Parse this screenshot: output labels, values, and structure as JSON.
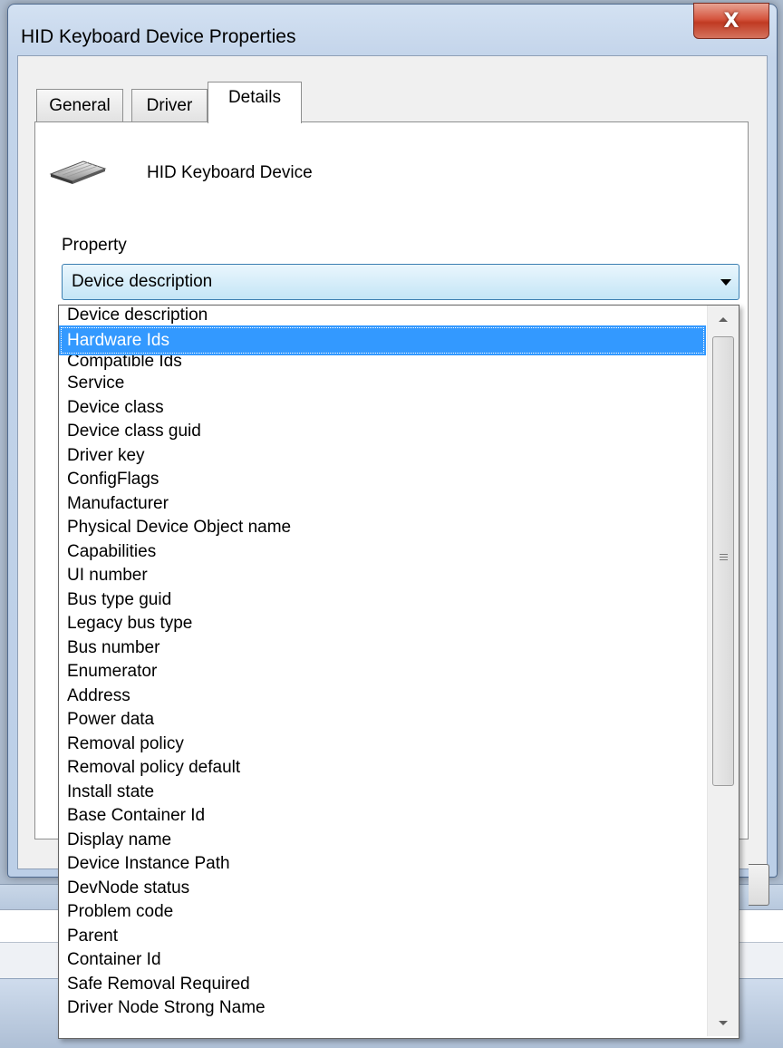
{
  "window": {
    "title": "HID Keyboard Device Properties",
    "close_glyph": "X"
  },
  "tabs": [
    {
      "label": "General"
    },
    {
      "label": "Driver"
    },
    {
      "label": "Details"
    }
  ],
  "active_tab": "Details",
  "device": {
    "name": "HID Keyboard Device",
    "icon": "keyboard-icon"
  },
  "property": {
    "label": "Property",
    "selected_value": "Device description"
  },
  "dropdown": {
    "highlighted": "Hardware Ids",
    "options": [
      "Device description",
      "Hardware Ids",
      "Compatible Ids",
      "Service",
      "Device class",
      "Device class guid",
      "Driver key",
      "ConfigFlags",
      "Manufacturer",
      "Physical Device Object name",
      "Capabilities",
      "UI number",
      "Bus type guid",
      "Legacy bus type",
      "Bus number",
      "Enumerator",
      "Address",
      "Power data",
      "Removal policy",
      "Removal policy default",
      "Install state",
      "Base Container Id",
      "Display name",
      "Device Instance Path",
      "DevNode status",
      "Problem code",
      "Parent",
      "Container Id",
      "Safe Removal Required",
      "Driver Node Strong Name"
    ]
  },
  "colors": {
    "selection": "#3399ff",
    "close_button": "#c8452d"
  }
}
